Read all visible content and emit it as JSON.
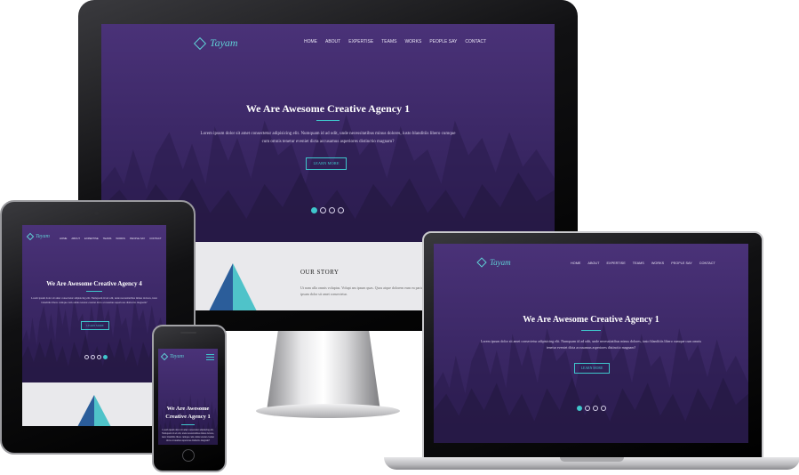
{
  "brand": "Tayam",
  "nav": [
    "Home",
    "About",
    "Expertise",
    "Teams",
    "Works",
    "People Say",
    "Contact"
  ],
  "hero": {
    "headline_desktop": "We Are Awesome Creative Agency 1",
    "headline_tablet": "We Are Awesome Creative Agency 4",
    "headline_laptop": "We Are Awesome Creative Agency 1",
    "headline_phone_line1": "We Are Awesome",
    "headline_phone_line2": "Creative Agency 1",
    "lead": "Lorem ipsum dolor sit amet consectetur adipisicing elit. Numquam id ad odit, unde necessitatibus minus dolores, iusto blanditiis libero cumque cum omnis tenetur eveniet dicta accusamus asperiores distinctio magnam?",
    "button": "Learn More"
  },
  "story": {
    "title": "Our Story",
    "text": "Ut nam ulla omnis voluptas. Volupt am ipsum quas. Quos atque dolorem eum ea pariatur. Lorem ipsum dolor sit amet consectetur."
  },
  "slider": {
    "desktop_active": 1,
    "tablet_active": 4,
    "laptop_active": 1,
    "count": 4
  },
  "colors": {
    "hero": "#3d2968",
    "accent": "#3fc6cc",
    "story_bg": "#e9e9ec"
  }
}
